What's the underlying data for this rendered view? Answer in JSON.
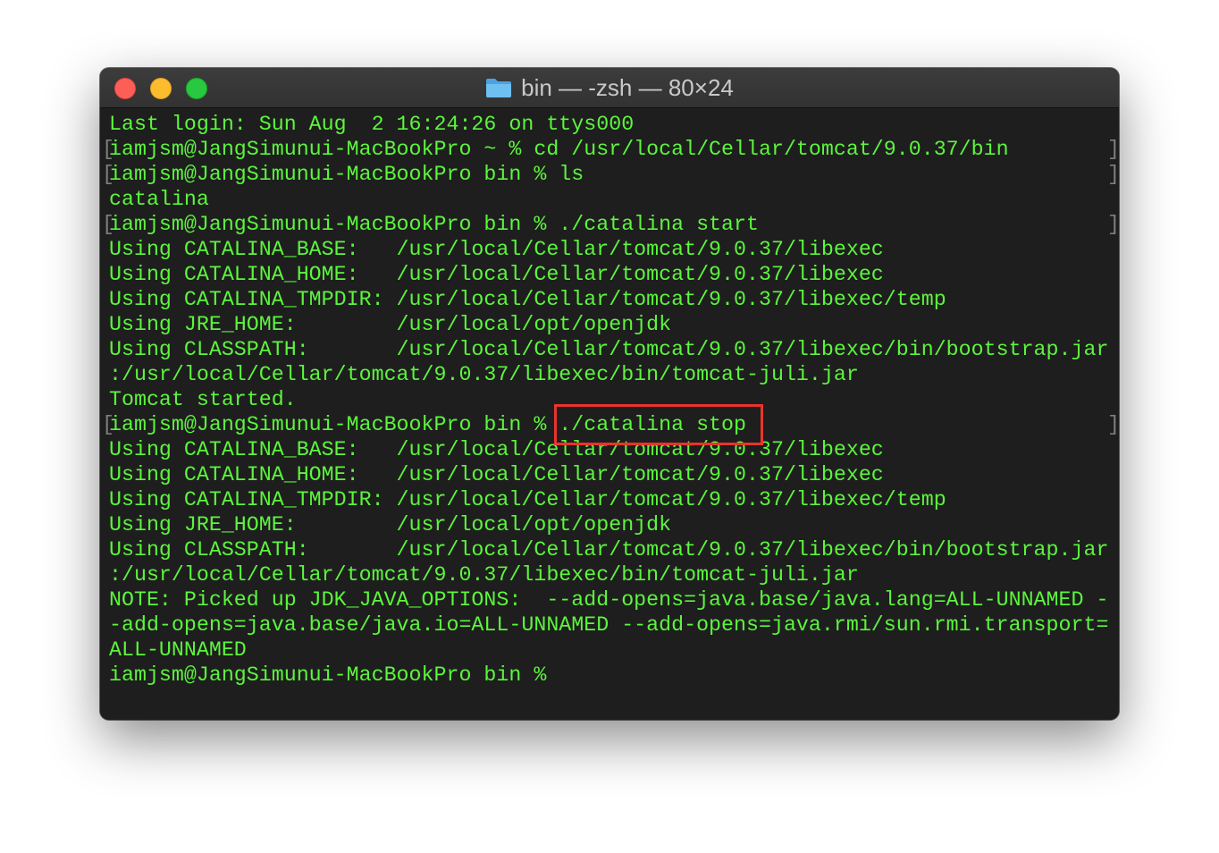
{
  "window": {
    "title": "bin — -zsh — 80×24",
    "folder_icon": "folder-icon",
    "buttons": {
      "close": "close-button",
      "minimize": "minimize-button",
      "maximize": "maximize-button"
    }
  },
  "colors": {
    "terminal_background": "#1e1e1e",
    "terminal_text": "#5cf53d",
    "mark_color": "#7e7e7e",
    "highlight_border": "#e8342c",
    "close": "#fd5f57",
    "minimize": "#fdbc2e",
    "maximize": "#28c840"
  },
  "terminal": {
    "lines": [
      "Last login: Sun Aug  2 16:24:26 on ttys000",
      "iamjsm@JangSimunui-MacBookPro ~ % cd /usr/local/Cellar/tomcat/9.0.37/bin",
      "iamjsm@JangSimunui-MacBookPro bin % ls",
      "catalina",
      "iamjsm@JangSimunui-MacBookPro bin % ./catalina start",
      "Using CATALINA_BASE:   /usr/local/Cellar/tomcat/9.0.37/libexec",
      "Using CATALINA_HOME:   /usr/local/Cellar/tomcat/9.0.37/libexec",
      "Using CATALINA_TMPDIR: /usr/local/Cellar/tomcat/9.0.37/libexec/temp",
      "Using JRE_HOME:        /usr/local/opt/openjdk",
      "Using CLASSPATH:       /usr/local/Cellar/tomcat/9.0.37/libexec/bin/bootstrap.jar",
      ":/usr/local/Cellar/tomcat/9.0.37/libexec/bin/tomcat-juli.jar",
      "Tomcat started.",
      "iamjsm@JangSimunui-MacBookPro bin % ./catalina stop",
      "Using CATALINA_BASE:   /usr/local/Cellar/tomcat/9.0.37/libexec",
      "Using CATALINA_HOME:   /usr/local/Cellar/tomcat/9.0.37/libexec",
      "Using CATALINA_TMPDIR: /usr/local/Cellar/tomcat/9.0.37/libexec/temp",
      "Using JRE_HOME:        /usr/local/opt/openjdk",
      "Using CLASSPATH:       /usr/local/Cellar/tomcat/9.0.37/libexec/bin/bootstrap.jar",
      ":/usr/local/Cellar/tomcat/9.0.37/libexec/bin/tomcat-juli.jar",
      "NOTE: Picked up JDK_JAVA_OPTIONS:  --add-opens=java.base/java.lang=ALL-UNNAMED -",
      "-add-opens=java.base/java.io=ALL-UNNAMED --add-opens=java.rmi/sun.rmi.transport=",
      "ALL-UNNAMED",
      "iamjsm@JangSimunui-MacBookPro bin % "
    ],
    "marked_lines": [
      1,
      2,
      4,
      12
    ],
    "mark_left": "[",
    "mark_right": "]",
    "highlighted_command": "./catalina stop"
  }
}
